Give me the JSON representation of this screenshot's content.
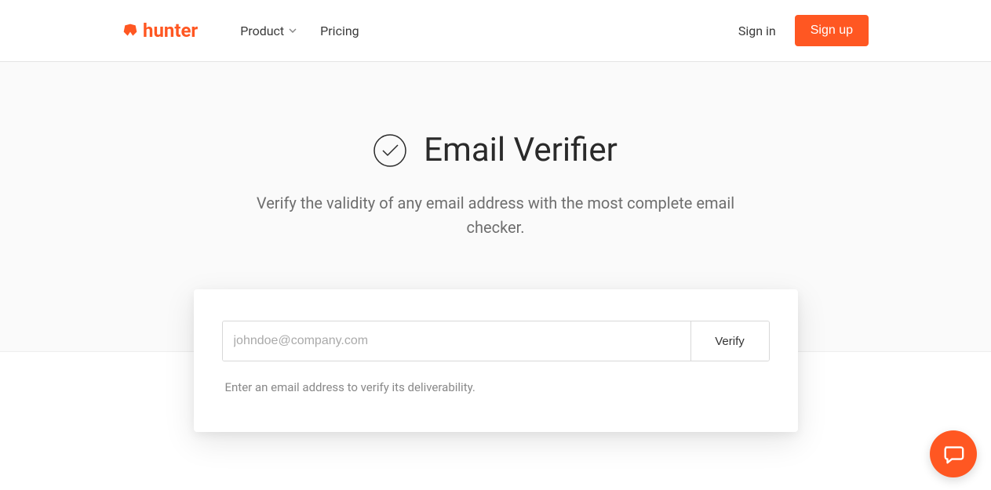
{
  "header": {
    "logo_text": "hunter",
    "nav": {
      "product": "Product",
      "pricing": "Pricing"
    },
    "signin": "Sign in",
    "signup": "Sign up"
  },
  "hero": {
    "title": "Email Verifier",
    "subtitle": "Verify the validity of any email address with the most complete email checker."
  },
  "form": {
    "placeholder": "johndoe@company.com",
    "verify_label": "Verify",
    "helper": "Enter an email address to verify its deliverability."
  },
  "colors": {
    "accent": "#ff5722"
  }
}
